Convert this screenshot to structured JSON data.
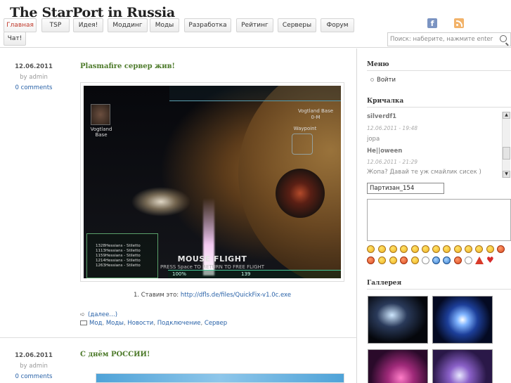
{
  "site": {
    "title": "The StarPort in Russia"
  },
  "nav": {
    "items": [
      "Главная",
      "TSP",
      "Идея!",
      "Моддинг",
      "Моды",
      "Разработка",
      "Рейтинг",
      "Серверы",
      "Форум"
    ],
    "second_row": [
      "Чат!"
    ],
    "active": "Главная"
  },
  "search": {
    "placeholder": "Поиск: наберите, нажмите enter"
  },
  "posts": [
    {
      "date": "12.06.2011",
      "author": "by admin",
      "comments": "0 comments",
      "title": "Plasmafire сервер жив!",
      "caption_prefix": "1. Ставим это: ",
      "caption_link": "http://dfls.de/files/QuickFix-v1.0c.exe",
      "more": "(далее…)",
      "tags": [
        "Мод",
        "Моды",
        "Новости",
        "Подключение",
        "Сервер"
      ]
    },
    {
      "date": "12.06.2011",
      "author": "by admin",
      "comments": "0 comments",
      "title": "С днём РОССИИ!"
    }
  ],
  "game_screenshot": {
    "base_label_left": "Vogtland Base",
    "base_label_right": "Vogtland Base",
    "base_distance": "0-M",
    "waypoint": "Waypoint",
    "mouse_flight": "MOUSE FLIGHT",
    "mouse_sub": "PRESS Space TO RETURN TO FREE FLIGHT",
    "speed": "100%",
    "speed_value": "139",
    "list": [
      "1328Hessians - Stiletto",
      "1113Hessians - Stiletto",
      "1159Hessians - Stiletto",
      "1214Hessians - Stiletto",
      "1263Hessians - Stiletto"
    ]
  },
  "sidebar": {
    "menu_title": "Меню",
    "menu_login": "Войти",
    "shout_title": "Кричалка",
    "shouts": [
      {
        "name": "silverdf1",
        "time": "12.06.2011 - 19:48",
        "msg": "jopa"
      },
      {
        "name": "He||oween",
        "time": "12.06.2011 - 21:29",
        "msg": "Жопа? Давай те уж смайлик сисек )"
      }
    ],
    "name_value": "Партизан_154",
    "gallery_title": "Галлерея"
  },
  "colors": {
    "accent_link": "#2962a8",
    "title_green": "#4d7a2a",
    "active_nav": "#c0392b"
  },
  "icons": [
    "facebook-icon",
    "rss-icon",
    "search-icon",
    "arrow-more-icon",
    "folder-icon"
  ]
}
